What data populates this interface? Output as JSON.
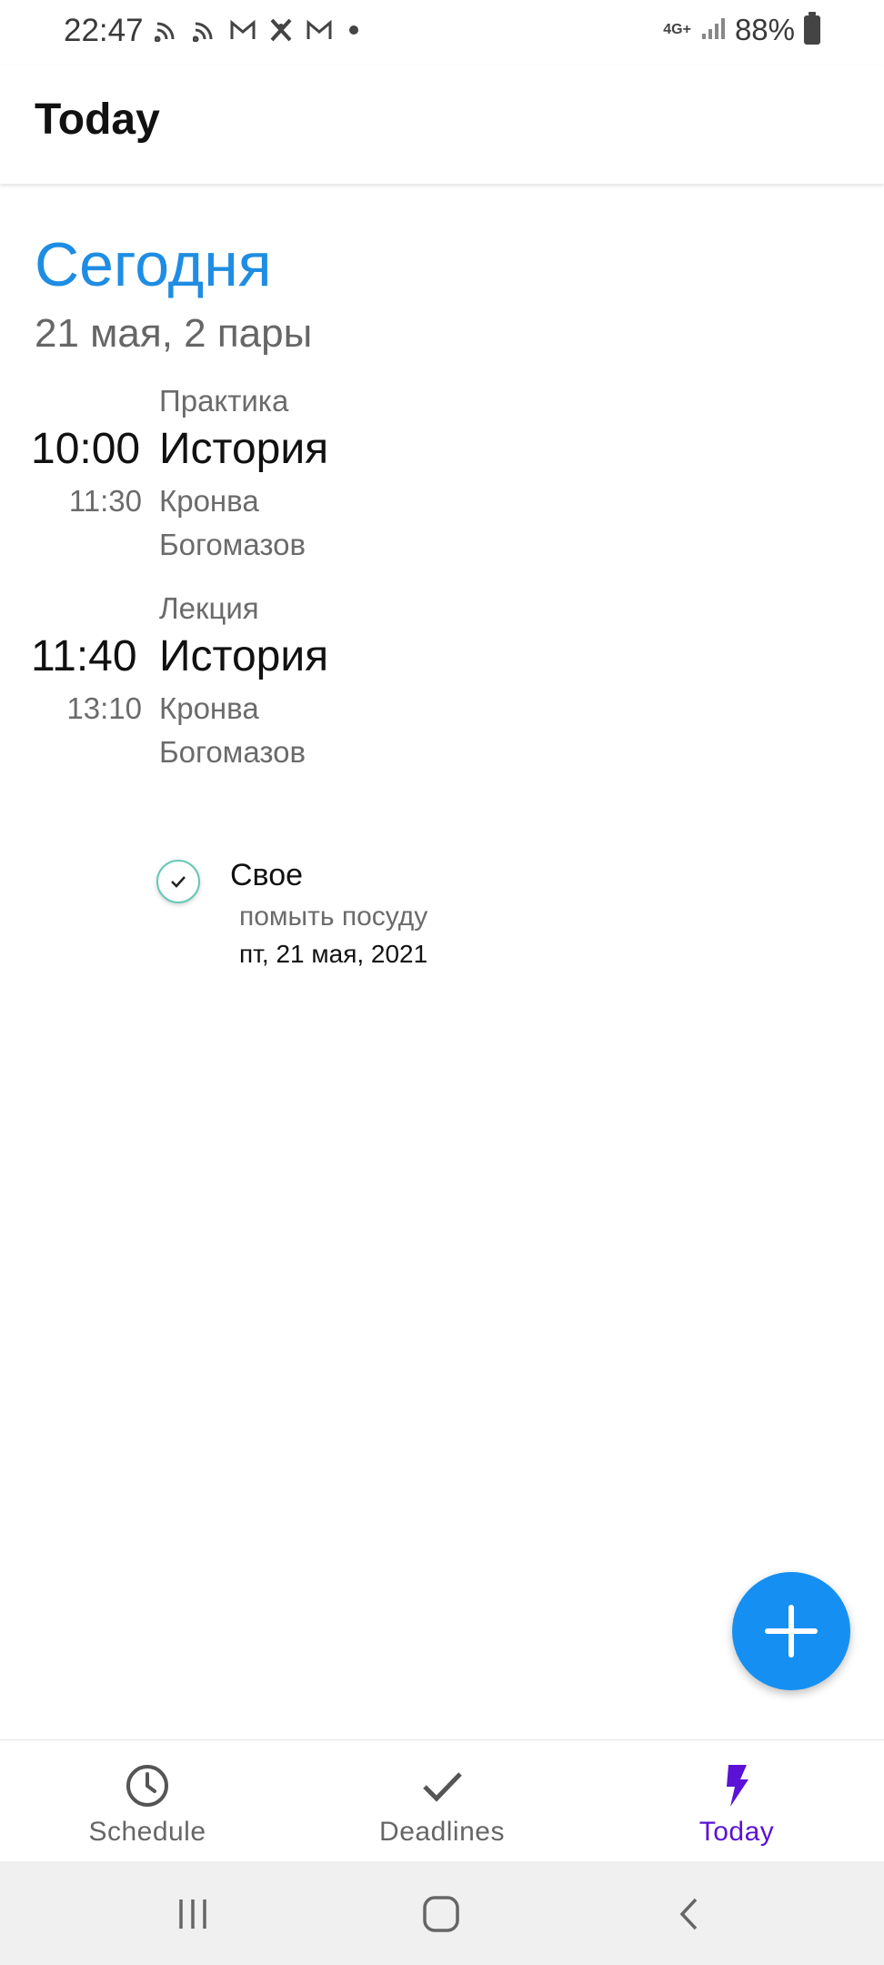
{
  "status_bar": {
    "time": "22:47",
    "network": "4G+",
    "battery": "88%",
    "left_icons": [
      "cast-icon",
      "cast-icon",
      "gmail-icon",
      "app-icon",
      "gmail-icon"
    ]
  },
  "app_bar": {
    "title": "Today"
  },
  "day": {
    "heading": "Сегодня",
    "subtitle": "21 мая, 2 пары"
  },
  "lessons": [
    {
      "type": "Практика",
      "start": "10:00",
      "end": "11:30",
      "name": "История",
      "room": "Кронва",
      "teacher": "Богомазов"
    },
    {
      "type": "Лекция",
      "start": "11:40",
      "end": "13:10",
      "name": "История",
      "room": "Кронва",
      "teacher": "Богомазов"
    }
  ],
  "task": {
    "title": "Свое",
    "description": "помыть посуду",
    "date": "пт, 21 мая, 2021"
  },
  "bottom_nav": {
    "items": [
      {
        "label": "Schedule",
        "icon": "clock-icon",
        "active": false
      },
      {
        "label": "Deadlines",
        "icon": "check-icon",
        "active": false
      },
      {
        "label": "Today",
        "icon": "lightning-icon",
        "active": true
      }
    ]
  },
  "colors": {
    "accent_blue": "#1e8de3",
    "fab_blue": "#1590f2",
    "active_purple": "#5b12d6",
    "check_ring": "#67c8b8"
  }
}
